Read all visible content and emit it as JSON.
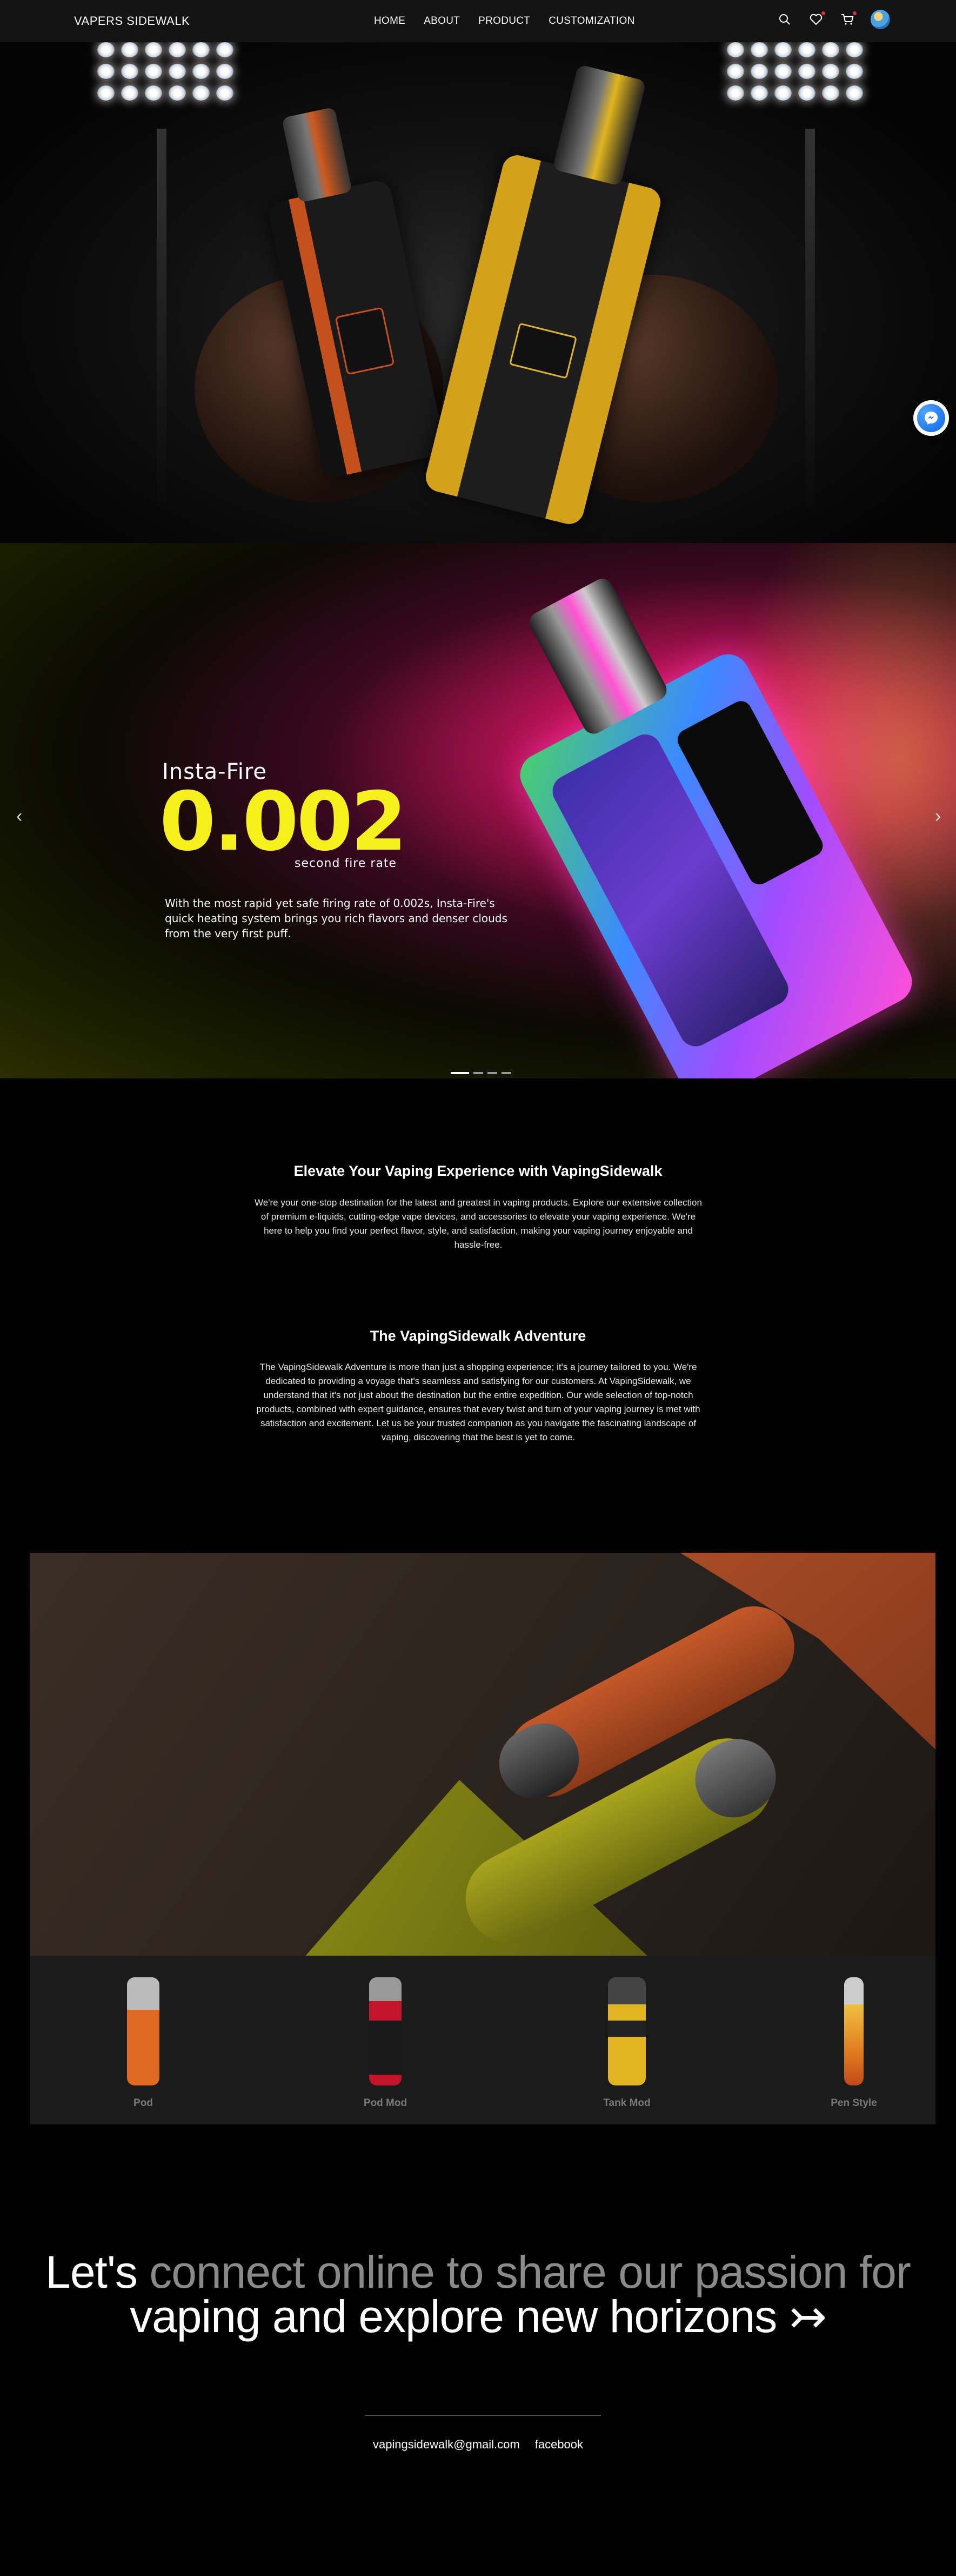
{
  "nav": {
    "brand": "VAPERS SIDEWALK",
    "menu": [
      "HOME",
      "ABOUT",
      "PRODUCT",
      "CUSTOMIZATION"
    ],
    "icons": [
      "search-icon",
      "heart-icon",
      "cart-icon",
      "avatar"
    ]
  },
  "hero_slide": {
    "kicker": "Insta-Fire",
    "value": "0.002",
    "unit": "second fire rate",
    "description": "With the most rapid yet safe firing rate of 0.002s, Insta-Fire's quick heating system brings you rich flavors and denser clouds from the very first puff.",
    "accent_color": "#f6f01c",
    "slide_count": 4,
    "active_slide": 1
  },
  "intro": {
    "title": "Elevate Your Vaping Experience with VapingSidewalk",
    "body": "We're your one-stop destination for the latest and greatest in vaping products. Explore our extensive collection of premium e-liquids, cutting-edge vape devices, and accessories to elevate your vaping experience. We're here to help you find your perfect flavor, style, and satisfaction, making your vaping journey enjoyable and hassle-free."
  },
  "adventure": {
    "title": "The VapingSidewalk Adventure",
    "body": "The VapingSidewalk Adventure is more than just a shopping experience; it's a journey tailored to you. We're dedicated to providing a voyage that's seamless and satisfying for our customers. At VapingSidewalk, we understand that it's not just about the destination but the entire expedition. Our wide selection of top-notch products, combined with expert guidance, ensures that every twist and turn of your vaping journey is met with satisfaction and excitement. Let us be your trusted companion as you navigate the fascinating landscape of vaping, discovering that the best is yet to come."
  },
  "categories": [
    {
      "label": "Pod"
    },
    {
      "label": "Pod Mod"
    },
    {
      "label": "Tank Mod"
    },
    {
      "label": "Pen Style"
    }
  ],
  "cta": {
    "part1": "Let's",
    "part2": "connect online to share our passion for",
    "part3": "vaping and explore new horizons",
    "arrow": "↣",
    "email": "vapingsidewalk@gmail.com",
    "social": "facebook"
  }
}
